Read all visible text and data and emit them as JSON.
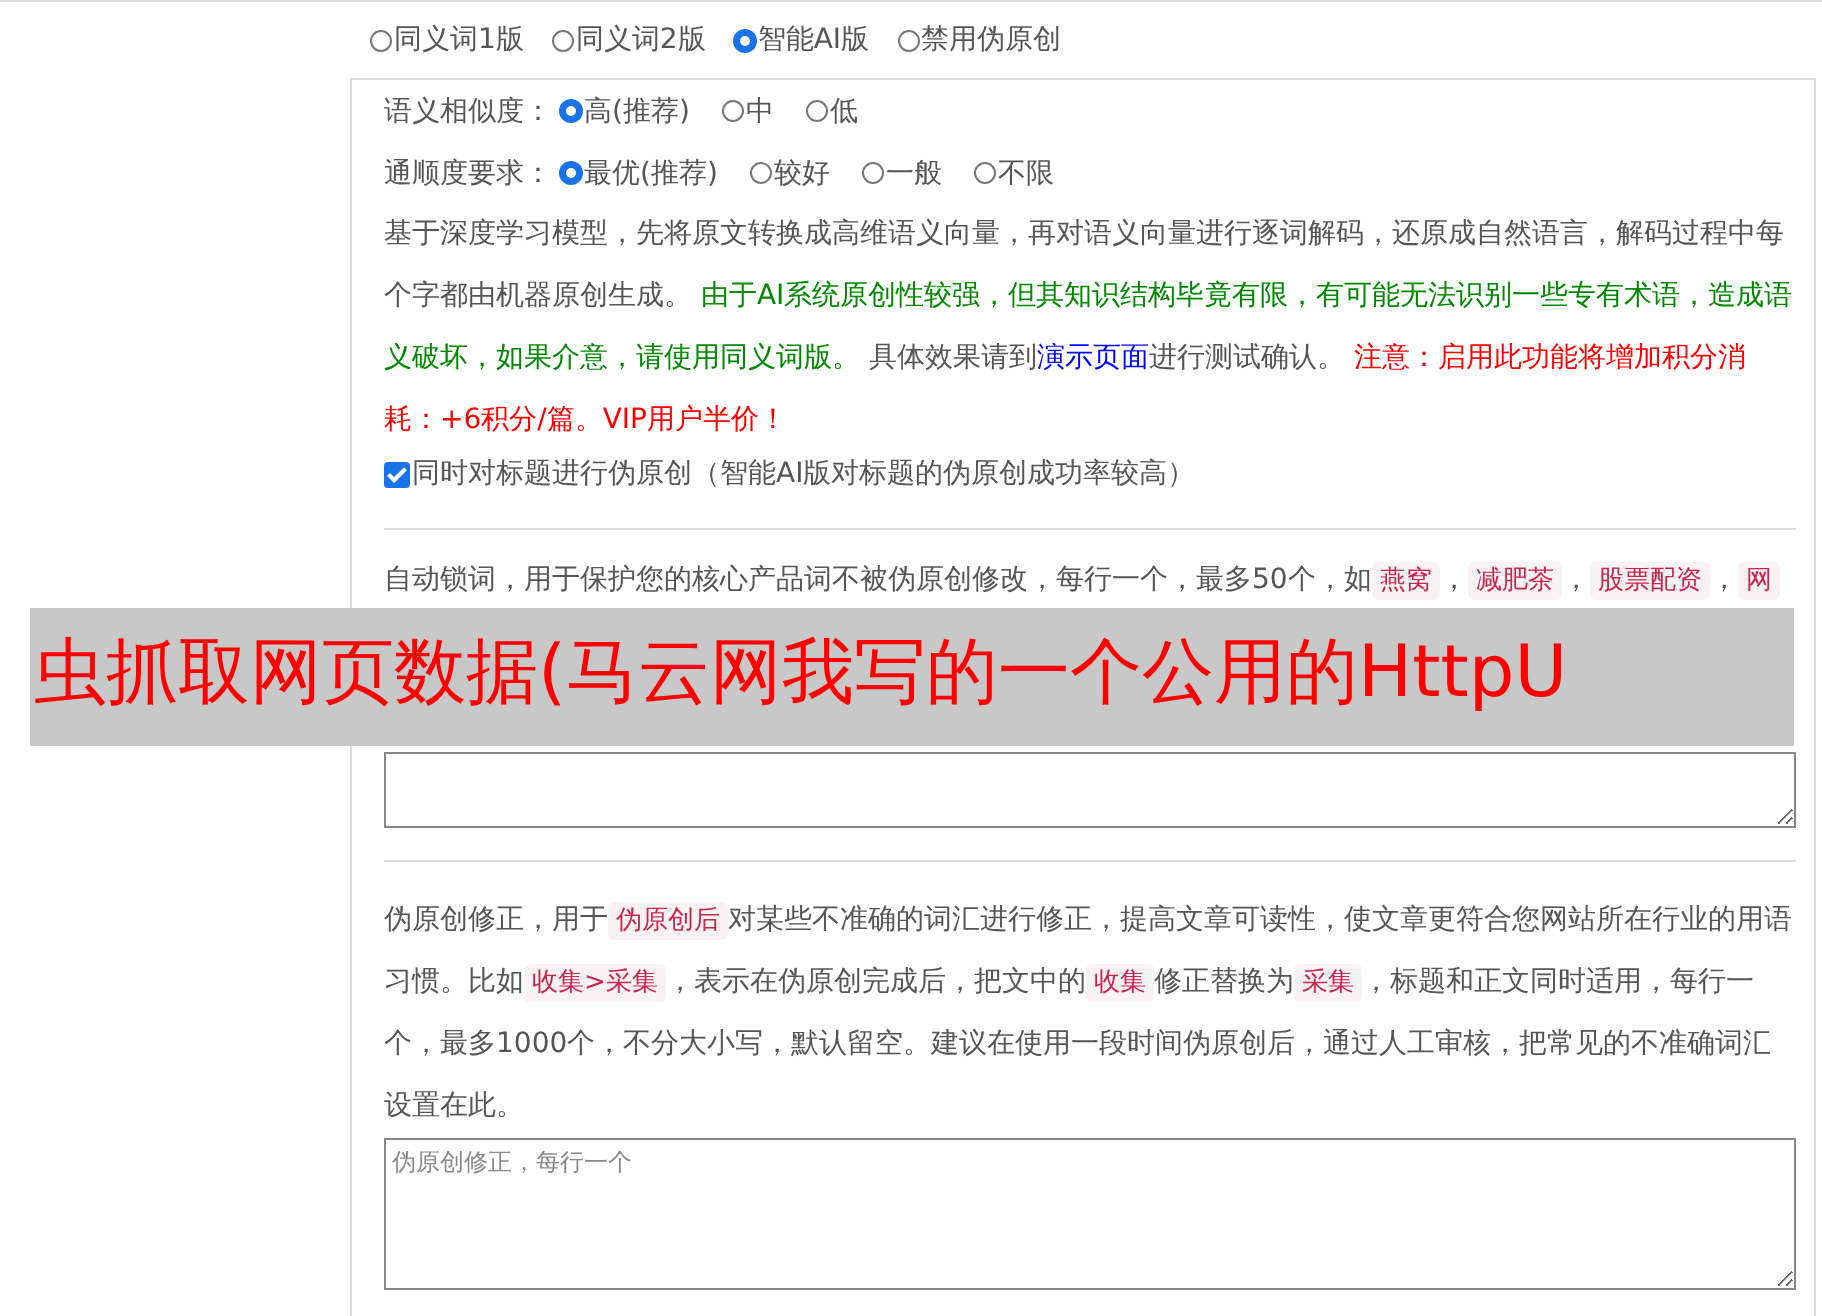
{
  "version_options": [
    {
      "label": "同义词1版",
      "selected": false
    },
    {
      "label": "同义词2版",
      "selected": false
    },
    {
      "label": "智能AI版",
      "selected": true
    },
    {
      "label": "禁用伪原创",
      "selected": false
    }
  ],
  "ai_panel": {
    "option_groups": [
      {
        "label": "语义相似度：",
        "options": [
          {
            "label": "高(推荐)",
            "selected": true
          },
          {
            "label": "中",
            "selected": false
          },
          {
            "label": "低",
            "selected": false
          }
        ]
      },
      {
        "label": "通顺度要求：",
        "options": [
          {
            "label": "最优(推荐)",
            "selected": true
          },
          {
            "label": "较好",
            "selected": false
          },
          {
            "label": "一般",
            "selected": false
          },
          {
            "label": "不限",
            "selected": false
          }
        ]
      }
    ],
    "description": [
      {
        "kind": "plain",
        "text": "基于深度学习模型，先将原文转换成高维语义向量，再对语义向量进行逐词解码，还原成自然语言，解码过程中每个字都由机器原创生成。 "
      },
      {
        "kind": "green",
        "text": "由于AI系统原创性较强，但其知识结构毕竟有限，有可能无法识别一些专有术语，造成语义破坏，如果介意，请使用同义词版。"
      },
      {
        "kind": "plain",
        "text": " 具体效果请到"
      },
      {
        "kind": "link",
        "text": "演示页面"
      },
      {
        "kind": "plain",
        "text": "进行测试确认。 "
      },
      {
        "kind": "red",
        "text": "注意：启用此功能将增加积分消耗：+6积分/篇。VIP用户半价！"
      }
    ],
    "title_option": {
      "label": "同时对标题进行伪原创（智能AI版对标题的伪原创成功率较高）",
      "checked": true
    }
  },
  "lock_words": {
    "description": [
      {
        "kind": "plain",
        "text": "自动锁词，用于保护您的核心产品词不被伪原创修改，每行一个，最多50个，如"
      },
      {
        "kind": "code",
        "text": "燕窝"
      },
      {
        "kind": "plain",
        "text": "，"
      },
      {
        "kind": "code",
        "text": "减肥茶"
      },
      {
        "kind": "plain",
        "text": "，"
      },
      {
        "kind": "code",
        "text": "股票配资"
      },
      {
        "kind": "plain",
        "text": "，"
      },
      {
        "kind": "code",
        "text": "网"
      }
    ]
  },
  "correction": {
    "description": [
      {
        "kind": "plain",
        "text": "伪原创修正，用于"
      },
      {
        "kind": "code",
        "text": "伪原创后"
      },
      {
        "kind": "plain",
        "text": "对某些不准确的词汇进行修正，提高文章可读性，使文章更符合您网站所在行业的用语习惯。比如"
      },
      {
        "kind": "code",
        "text": "收集>采集"
      },
      {
        "kind": "plain",
        "text": "，表示在伪原创完成后，把文中的"
      },
      {
        "kind": "code",
        "text": "收集"
      },
      {
        "kind": "plain",
        "text": "修正替换为"
      },
      {
        "kind": "code",
        "text": "采集"
      },
      {
        "kind": "plain",
        "text": "，标题和正文同时适用，每行一个，最多1000个，不分大小写，默认留空。建议在使用一段时间伪原创后，通过人工审核，把常见的不准确词汇设置在此。"
      }
    ],
    "placeholder": "伪原创修正，每行一个"
  },
  "banner": {
    "text": "虫抓取网页数据(马云网我写的一个公用的HttpU"
  }
}
